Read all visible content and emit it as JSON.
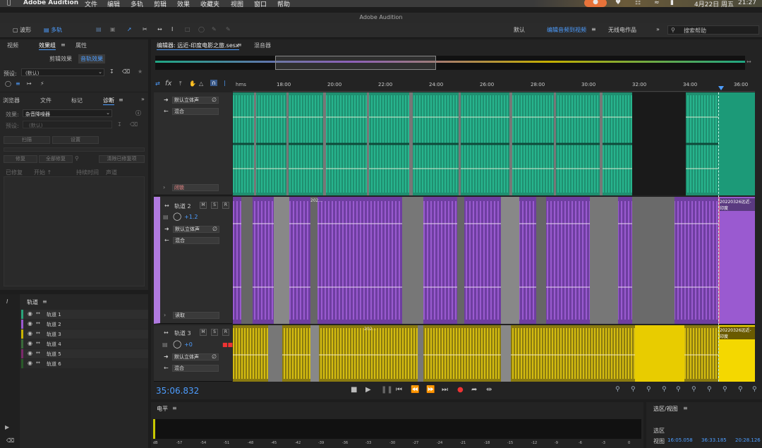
{
  "menubar": {
    "app": "Adobe Audition",
    "items": [
      "文件",
      "编辑",
      "多轨",
      "剪辑",
      "效果",
      "收藏夹",
      "视图",
      "窗口",
      "帮助"
    ],
    "date": "4月22日 周五",
    "time": "21:27"
  },
  "window": {
    "title": "Adobe Audition"
  },
  "toolbar": {
    "waveform_label": "波形",
    "multitrack_label": "多轨",
    "workspace_default": "默认",
    "workspace_edit_video": "编辑音频到视频",
    "workspace_radio": "无线电作品",
    "search_placeholder": "搜索帮助"
  },
  "effects_panel": {
    "tabs": [
      "视频",
      "效果组",
      "属性"
    ],
    "subtabs": [
      "剪辑效果",
      "音轨效果"
    ],
    "preset_label": "预设:",
    "preset_value": "(默认)"
  },
  "diag_panel": {
    "tabs": [
      "浏览器",
      "文件",
      "标记",
      "诊断"
    ],
    "effect_label": "效果:",
    "effect_value": "杂音降噪器",
    "preset_label": "预设:",
    "preset_value": "(默认)",
    "scan_label": "扫描",
    "settings_label": "设置",
    "repair_label": "修复",
    "repair_all_label": "全部修复",
    "clear_label": "清除已修复项",
    "columns": [
      "已修复",
      "开始 ↑",
      "持续时间",
      "声道"
    ]
  },
  "tracks_panel": {
    "title": "轨道",
    "items": [
      {
        "label": "轨道 1",
        "color": "#2aa37a"
      },
      {
        "label": "轨道 2",
        "color": "#9a5ad0"
      },
      {
        "label": "轨道 3",
        "color": "#c9b400"
      },
      {
        "label": "轨道 4",
        "color": "#3a6a3a"
      },
      {
        "label": "轨道 5",
        "color": "#7a2a6a"
      },
      {
        "label": "轨道 6",
        "color": "#2a5a2a"
      }
    ]
  },
  "editor": {
    "tab_label": "编辑器: 远近-印度电影之旅.sesx",
    "mixer_label": "混音器",
    "ruler_unit": "hms",
    "ruler_ticks": [
      "18:00",
      "20:00",
      "22:00",
      "24:00",
      "26:00",
      "28:00",
      "30:00",
      "32:00",
      "34:00",
      "36:00"
    ],
    "time_display": "35:06.832"
  },
  "tracks": [
    {
      "name": "",
      "output": "默认立体声",
      "mix": "混合",
      "mode": "闭锁",
      "color": "#1fa582",
      "volume": ""
    },
    {
      "name": "轨道 2",
      "output": "默认立体声",
      "mix": "混合",
      "mode": "读取",
      "color": "#8e52c8",
      "volume": "+1.2",
      "clip_label": "202...",
      "end_clip": "20220326远近-印度"
    },
    {
      "name": "轨道 3",
      "output": "默认立体声",
      "mix": "混合",
      "mode": "",
      "color": "#c4ae00",
      "volume": "+0",
      "clip_label": "202...",
      "end_clip": "20220326远近-印度"
    }
  ],
  "level_panel": {
    "title": "电平",
    "scale": [
      "dB",
      "-57",
      "-54",
      "-51",
      "-48",
      "-45",
      "-42",
      "-39",
      "-36",
      "-33",
      "-30",
      "-27",
      "-24",
      "-21",
      "-18",
      "-15",
      "-12",
      "-9",
      "-6",
      "-3",
      "0"
    ]
  },
  "selection_panel": {
    "title": "选区/视图",
    "selection_label": "选区",
    "view_label": "视图",
    "view_start": "16:05.058",
    "view_end": "36:33.185",
    "view_duration": "20:28.126"
  },
  "colors": {
    "accent": "#4d9dff",
    "track1": "#1fa582",
    "track2": "#8e52c8",
    "track3": "#c4ae00"
  }
}
